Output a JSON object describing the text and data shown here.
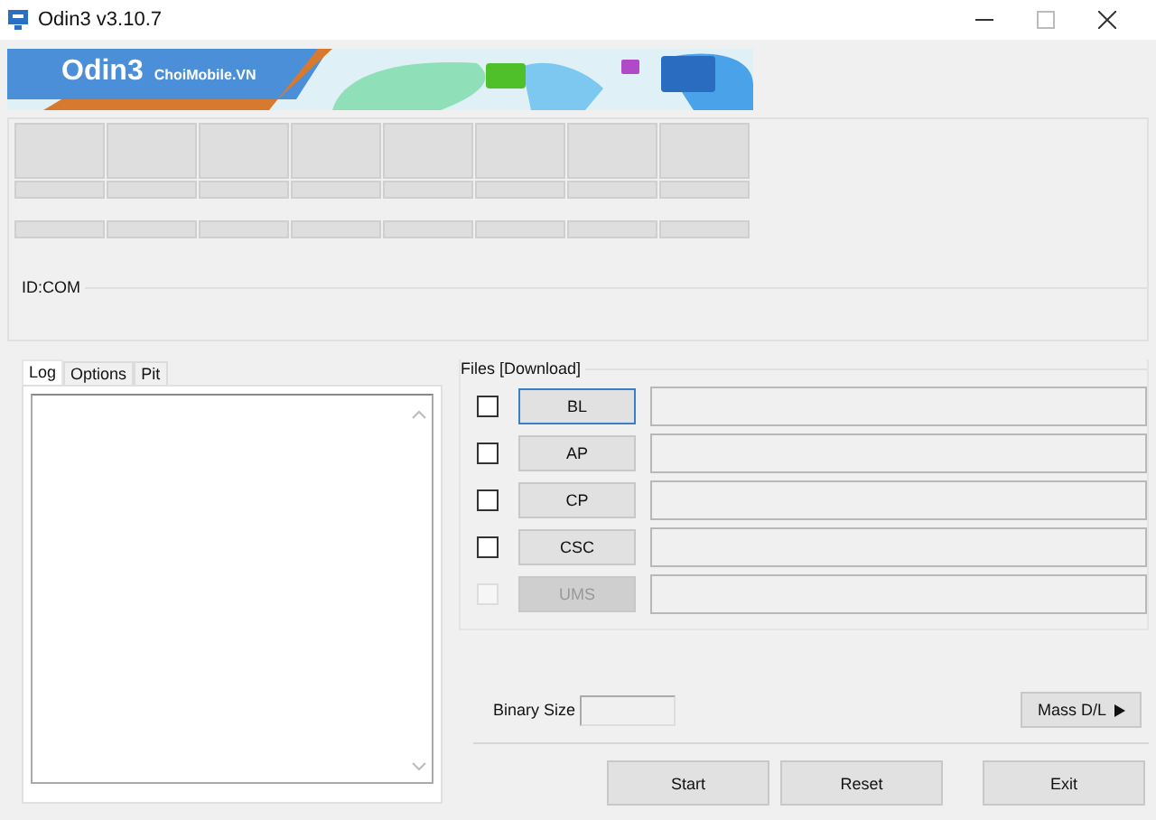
{
  "window": {
    "title": "Odin3 v3.10.7"
  },
  "banner": {
    "title": "Odin3",
    "subtitle": "ChoiMobile.VN"
  },
  "id_com": {
    "label": "ID:COM"
  },
  "tabs": [
    {
      "label": "Log",
      "selected": true
    },
    {
      "label": "Options",
      "selected": false
    },
    {
      "label": "Pit",
      "selected": false
    }
  ],
  "files": {
    "title": "Files [Download]",
    "rows": [
      {
        "label": "BL",
        "checked": false,
        "disabled": false,
        "focused": true
      },
      {
        "label": "AP",
        "checked": false,
        "disabled": false,
        "focused": false
      },
      {
        "label": "CP",
        "checked": false,
        "disabled": false,
        "focused": false
      },
      {
        "label": "CSC",
        "checked": false,
        "disabled": false,
        "focused": false
      },
      {
        "label": "UMS",
        "checked": false,
        "disabled": true,
        "focused": false
      }
    ]
  },
  "binary_size": {
    "label": "Binary Size"
  },
  "mass_dl": {
    "label": "Mass D/L"
  },
  "buttons": [
    {
      "label": "Start"
    },
    {
      "label": "Reset"
    },
    {
      "label": "Exit"
    }
  ]
}
